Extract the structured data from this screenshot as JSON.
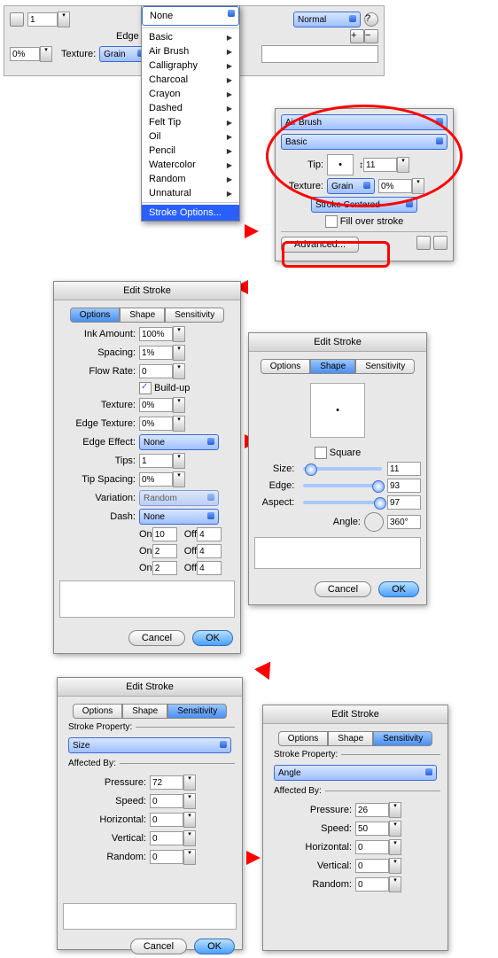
{
  "toolbar": {
    "stroke_width": "1",
    "mode": "Normal",
    "edge_label": "Edge",
    "texture_label": "Texture:",
    "texture_sel": "Grain",
    "texture_pct": "0%"
  },
  "menu": {
    "items": [
      "None",
      "Basic",
      "Air Brush",
      "Calligraphy",
      "Charcoal",
      "Crayon",
      "Dashed",
      "Felt Tip",
      "Oil",
      "Pencil",
      "Watercolor",
      "Random",
      "Unnatural"
    ],
    "footer": "Stroke Options..."
  },
  "stroke_panel": {
    "sel1": "Air Brush",
    "sel2": "Basic",
    "tip_label": "Tip:",
    "tip_size": "11",
    "texture_label": "Texture:",
    "texture_sel": "Grain",
    "texture_pct": "0%",
    "centered": "Stroke Centered",
    "fill_over": "Fill over stroke",
    "advanced": "Advanced..."
  },
  "edit_options": {
    "title": "Edit Stroke",
    "tabs": [
      "Options",
      "Shape",
      "Sensitivity"
    ],
    "ink_amount_label": "Ink Amount:",
    "ink_amount": "100%",
    "spacing_label": "Spacing:",
    "spacing": "1%",
    "flow_label": "Flow Rate:",
    "flow": "0",
    "buildup": "Build-up",
    "texture_label": "Texture:",
    "texture": "0%",
    "edge_tex_label": "Edge Texture:",
    "edge_tex": "0%",
    "edge_eff_label": "Edge Effect:",
    "edge_eff": "None",
    "tips_label": "Tips:",
    "tips": "1",
    "tip_spacing_label": "Tip Spacing:",
    "tip_spacing": "0%",
    "variation_label": "Variation:",
    "variation": "Random",
    "dash_label": "Dash:",
    "dash": "None",
    "on": "On",
    "off": "Off",
    "d1_on": "10",
    "d1_off": "4",
    "d2_on": "2",
    "d2_off": "4",
    "d3_on": "2",
    "d3_off": "4",
    "cancel": "Cancel",
    "ok": "OK"
  },
  "edit_shape": {
    "title": "Edit Stroke",
    "square": "Square",
    "size_label": "Size:",
    "size": "11",
    "edge_label": "Edge:",
    "edge": "93",
    "aspect_label": "Aspect:",
    "aspect": "97",
    "angle_label": "Angle:",
    "angle": "360°",
    "cancel": "Cancel",
    "ok": "OK"
  },
  "edit_sens_size": {
    "title": "Edit Stroke",
    "prop_label": "Stroke Property:",
    "prop": "Size",
    "aff_label": "Affected By:",
    "pressure_label": "Pressure:",
    "pressure": "72",
    "speed_label": "Speed:",
    "speed": "0",
    "horiz_label": "Horizontal:",
    "horiz": "0",
    "vert_label": "Vertical:",
    "vert": "0",
    "random_label": "Random:",
    "random": "0",
    "cancel": "Cancel",
    "ok": "OK"
  },
  "edit_sens_angle": {
    "title": "Edit Stroke",
    "prop_label": "Stroke Property:",
    "prop": "Angle",
    "aff_label": "Affected By:",
    "pressure_label": "Pressure:",
    "pressure": "26",
    "speed_label": "Speed:",
    "speed": "50",
    "horiz_label": "Horizontal:",
    "horiz": "0",
    "vert_label": "Vertical:",
    "vert": "0",
    "random_label": "Random:",
    "random": "0",
    "cancel": "Cancel",
    "ok": "OK"
  }
}
